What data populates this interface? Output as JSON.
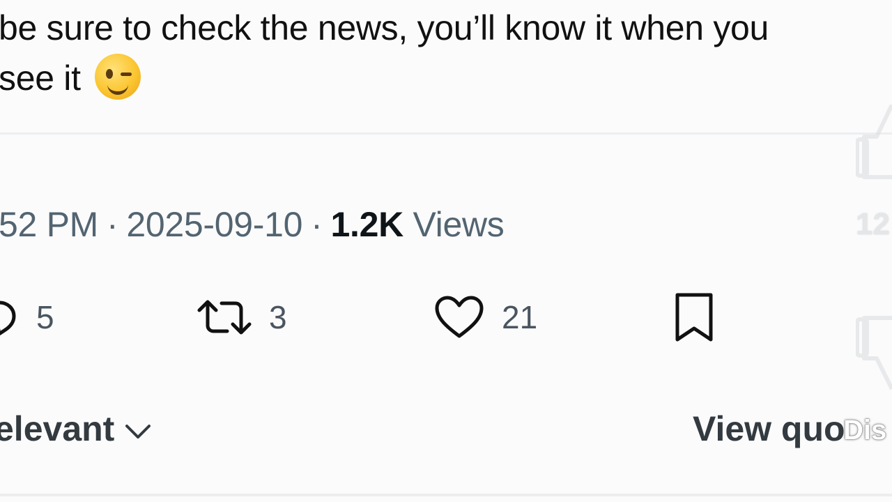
{
  "tweet": {
    "text_line1": "be sure to check the news, you’ll know it when you",
    "text_line2": "see it",
    "emoji": "winking-face"
  },
  "meta": {
    "time": "52 PM",
    "separator": "·",
    "date": "2025-09-10",
    "views_count": "1.2K",
    "views_label": "Views"
  },
  "actions": {
    "replies": "5",
    "retweets": "3",
    "likes": "21",
    "icons": [
      "reply-icon",
      "retweet-icon",
      "heart-icon",
      "bookmark-icon"
    ]
  },
  "replies_section": {
    "sort_label": "elevant",
    "view_quotes_label": "View quo"
  },
  "video_overlay": {
    "like_count": "12",
    "dislike_label": "Dis"
  },
  "colors": {
    "background": "#fbfbfb",
    "text": "#0f1419",
    "muted": "#536471",
    "divider": "#eceef0"
  }
}
